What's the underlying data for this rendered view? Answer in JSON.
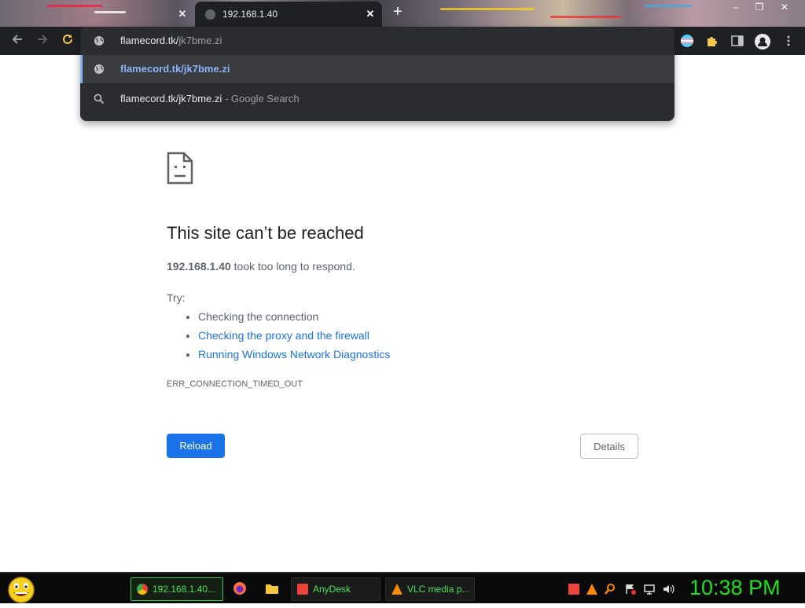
{
  "browser": {
    "tabs": [
      {
        "label": "",
        "active": false
      },
      {
        "label": "192.168.1.40",
        "active": true
      }
    ],
    "close_glyph": "✕",
    "new_tab_glyph": "+",
    "omnibox": {
      "input_typed": "flamecord.tk/",
      "input_autocomplete": "jk7bme.zi",
      "suggestions": [
        {
          "icon": "globe-icon",
          "text": "flamecord.tk/jk7bme.zi",
          "suffix": ""
        },
        {
          "icon": "search-icon",
          "text": "flamecord.tk/jk7bme.zi",
          "suffix": " - Google Search"
        }
      ]
    }
  },
  "error_page": {
    "title": "This site can’t be reached",
    "host": "192.168.1.40",
    "summary_rest": " took too long to respond.",
    "try_label": "Try:",
    "suggestions": [
      "Checking the connection",
      "Checking the proxy and the firewall",
      "Running Windows Network Diagnostics"
    ],
    "error_code": "ERR_CONNECTION_TIMED_OUT",
    "reload_label": "Reload",
    "details_label": "Details"
  },
  "taskbar": {
    "tasks": [
      {
        "label": "192.168.1.40...",
        "icon": "chrome-icon"
      },
      {
        "label": "AnyDesk",
        "icon": "anydesk-icon"
      },
      {
        "label": "VLC media p...",
        "icon": "vlc-icon"
      }
    ],
    "clock": "10:38 PM"
  },
  "colors": {
    "accent_blue": "#1a73e8",
    "link_blue_dark": "#8ab4f8",
    "clock_green": "#1de21d"
  }
}
